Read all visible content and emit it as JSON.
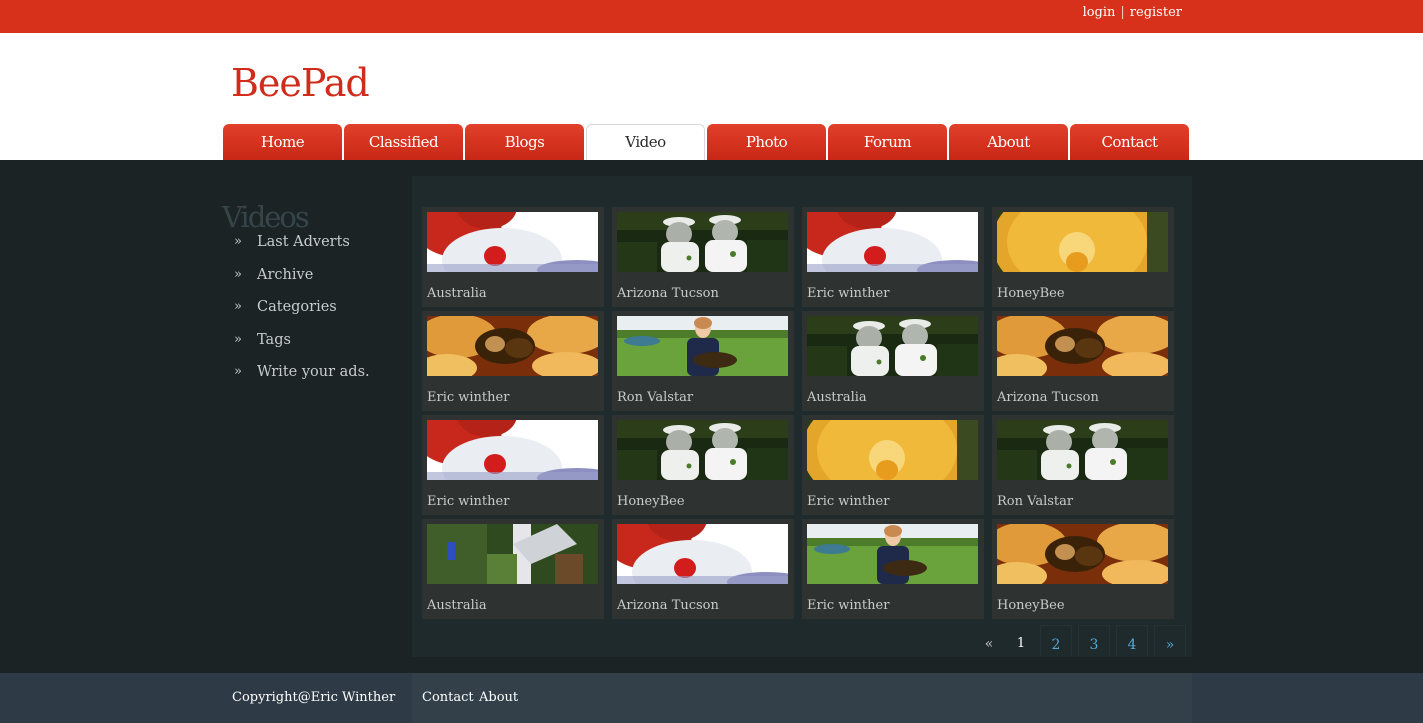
{
  "topbar": {
    "login": "login",
    "separator": "|",
    "register": "register"
  },
  "logo": "BeePad",
  "nav": [
    {
      "label": "Home",
      "active": false
    },
    {
      "label": "Classified",
      "active": false
    },
    {
      "label": "Blogs",
      "active": false
    },
    {
      "label": "Video",
      "active": true
    },
    {
      "label": "Photo",
      "active": false
    },
    {
      "label": "Forum",
      "active": false
    },
    {
      "label": "About",
      "active": false
    },
    {
      "label": "Contact",
      "active": false
    }
  ],
  "sidebar": {
    "title": "Videos",
    "bullet": "»",
    "items": [
      "Last Adverts",
      "Archive",
      "Categories",
      "Tags",
      "Write your ads."
    ]
  },
  "videos": [
    {
      "caption": "Australia",
      "thumb": "clown-face"
    },
    {
      "caption": "Arizona Tucson",
      "thumb": "beekeepers"
    },
    {
      "caption": "Eric winther",
      "thumb": "clown-face"
    },
    {
      "caption": "HoneyBee",
      "thumb": "honeycomb"
    },
    {
      "caption": "Eric winther",
      "thumb": "bee-closeup"
    },
    {
      "caption": "Ron Valstar",
      "thumb": "person-with-bees"
    },
    {
      "caption": "Australia",
      "thumb": "beekeepers"
    },
    {
      "caption": "Arizona Tucson",
      "thumb": "bee-closeup"
    },
    {
      "caption": "Eric winther",
      "thumb": "clown-face"
    },
    {
      "caption": "HoneyBee",
      "thumb": "beekeepers"
    },
    {
      "caption": "Eric winther",
      "thumb": "honeycomb"
    },
    {
      "caption": "Ron Valstar",
      "thumb": "beekeepers"
    },
    {
      "caption": "Australia",
      "thumb": "hive-garden"
    },
    {
      "caption": "Arizona Tucson",
      "thumb": "clown-face"
    },
    {
      "caption": "Eric winther",
      "thumb": "person-with-bees"
    },
    {
      "caption": "HoneyBee",
      "thumb": "bee-closeup"
    }
  ],
  "pagination": {
    "prev": "«",
    "pages": [
      "1",
      "2",
      "3",
      "4"
    ],
    "current": "1",
    "next": "»"
  },
  "footer": {
    "copyright": "Copyright@Eric Winther",
    "links": [
      "Contact",
      "About"
    ]
  },
  "colors": {
    "brand_red": "#d8311b",
    "link_blue": "#56a8d6",
    "panel": "#1f2a2c",
    "card": "#2e3331"
  }
}
